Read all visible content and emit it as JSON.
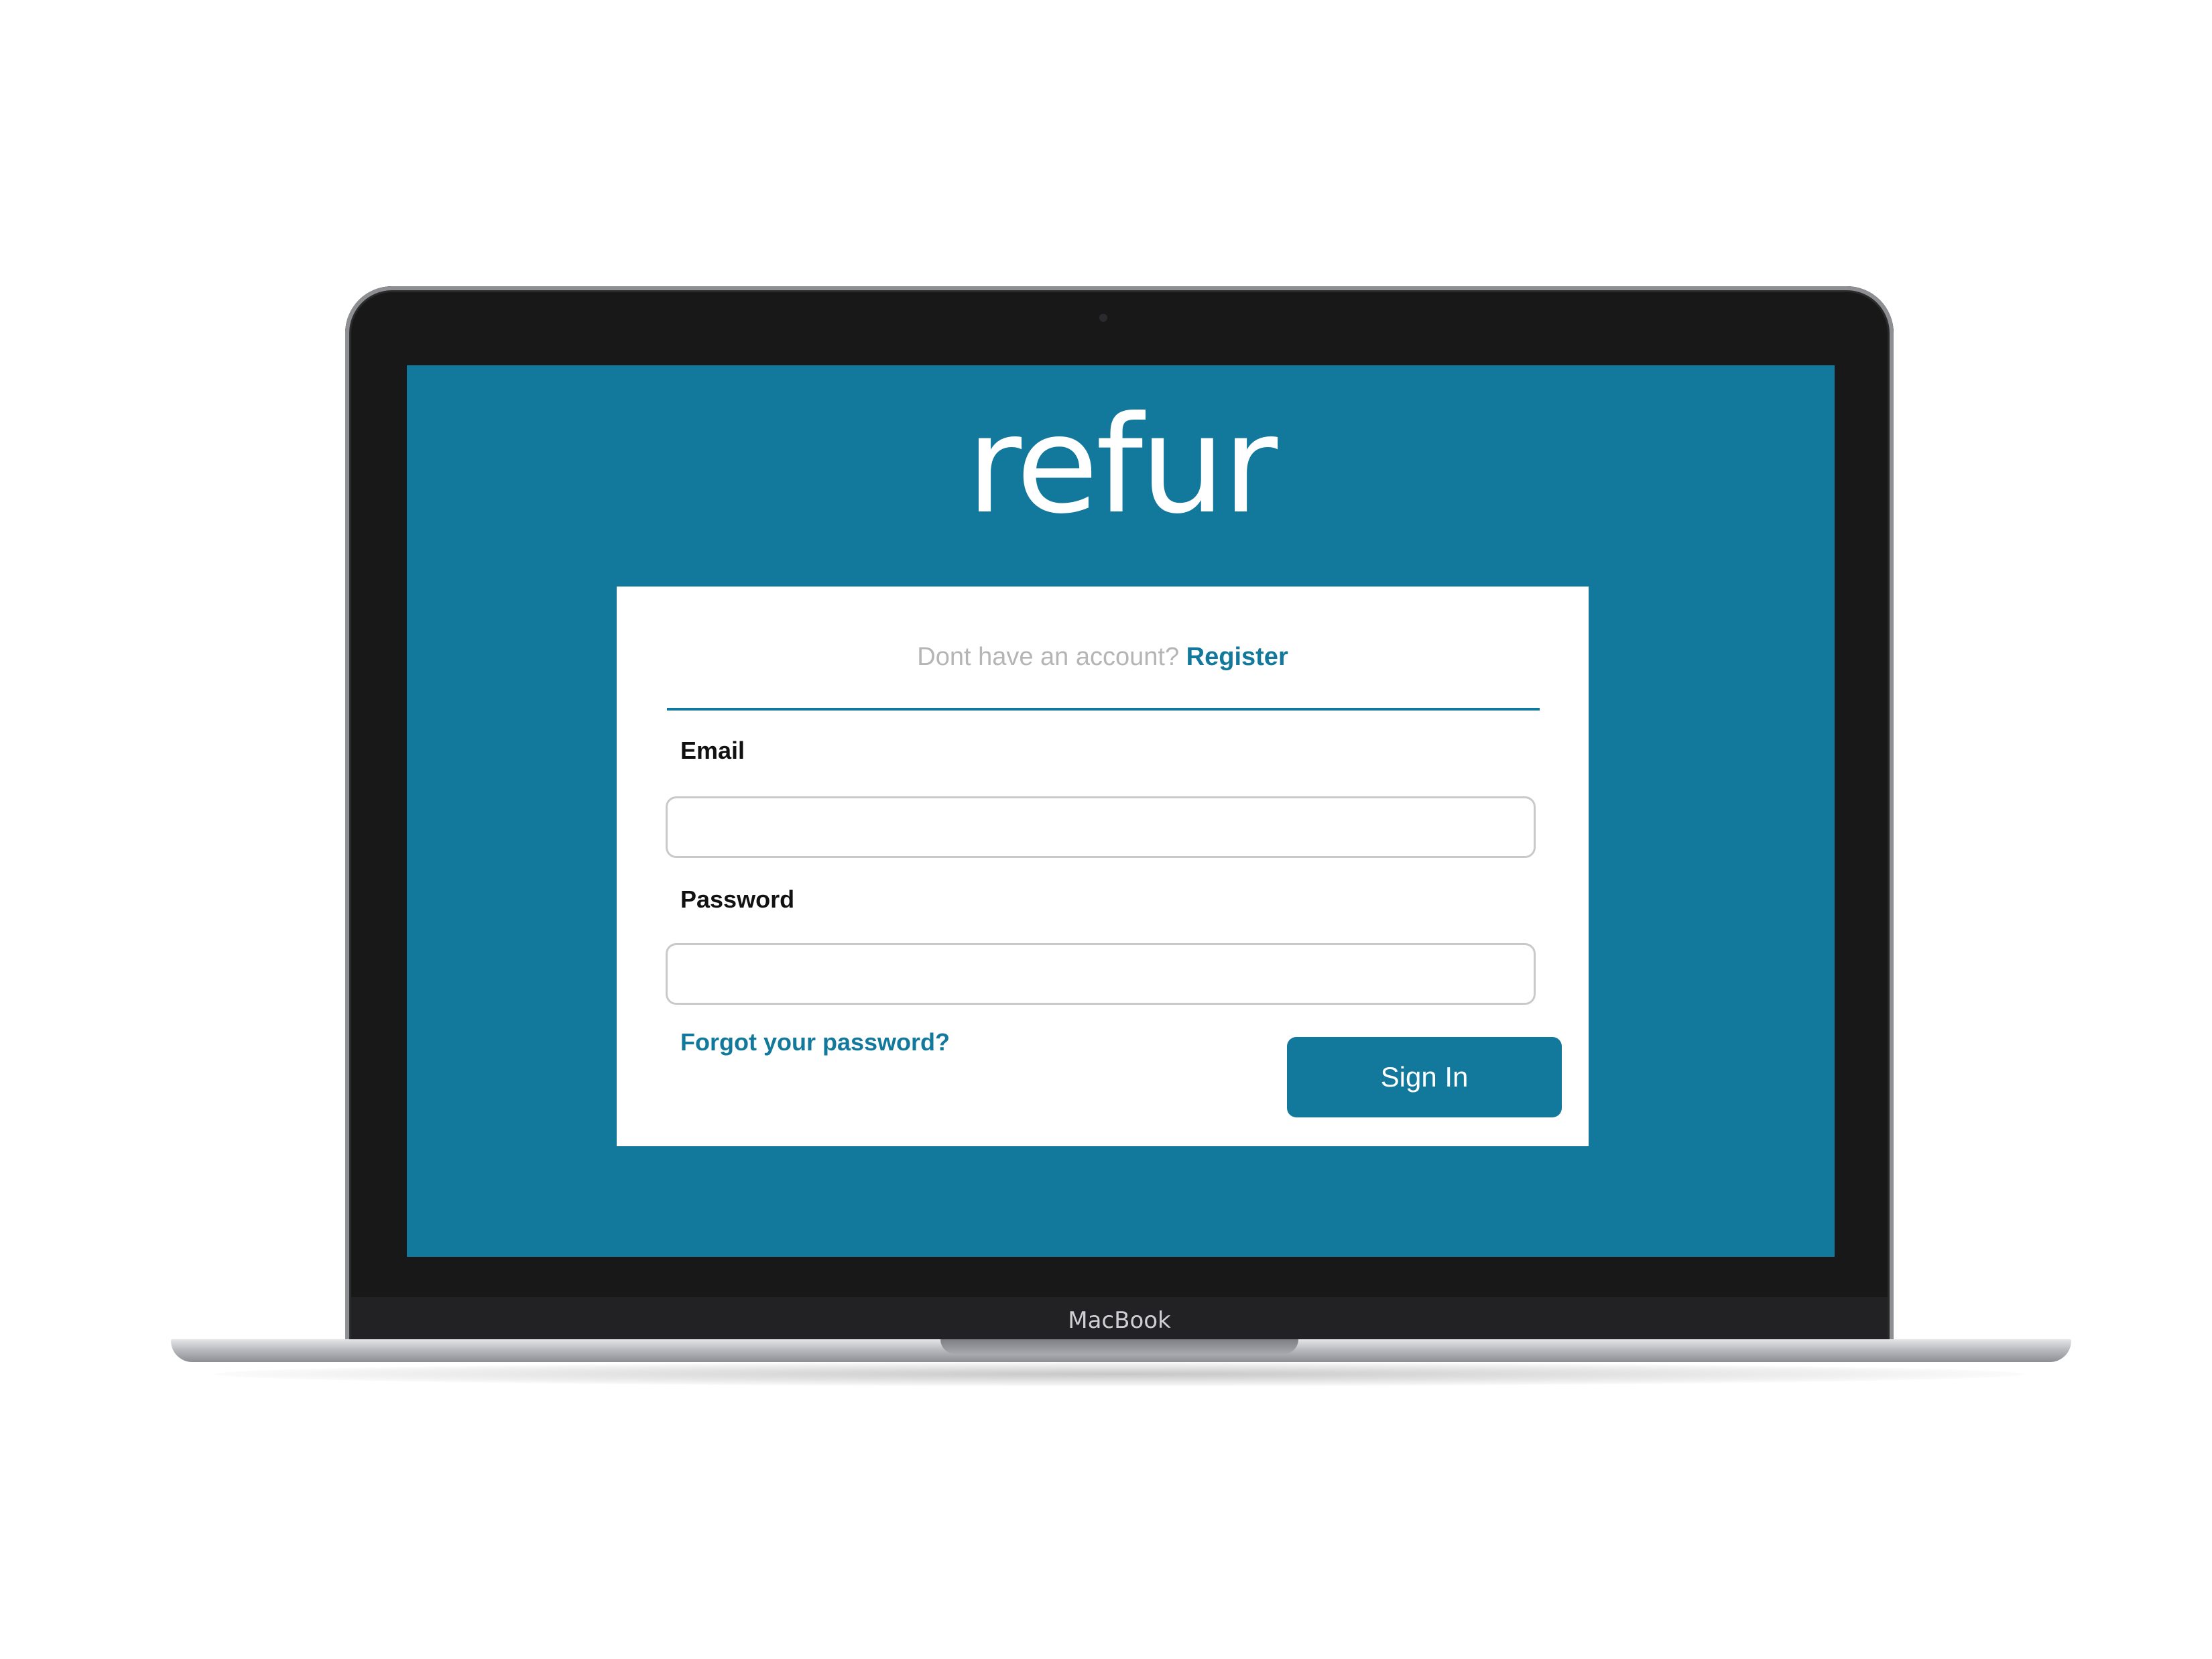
{
  "device": {
    "brand_label": "MacBook"
  },
  "app": {
    "logo_text": "refur"
  },
  "login": {
    "register_prompt": "Dont have an account?",
    "register_link": "Register",
    "email_label": "Email",
    "email_value": "",
    "password_label": "Password",
    "password_value": "",
    "forgot_password": "Forgot your password?",
    "sign_in_button": "Sign In"
  },
  "colors": {
    "accent": "#12789c",
    "card_background": "#ffffff",
    "muted_text": "#b5b5b5",
    "bezel": "#181818"
  }
}
